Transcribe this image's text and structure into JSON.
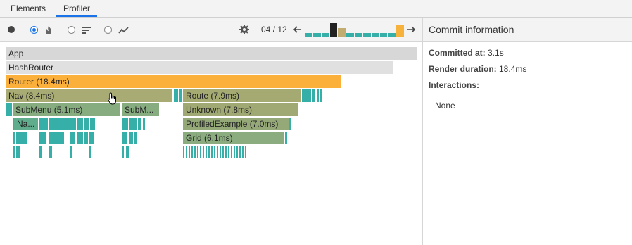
{
  "tabs": [
    {
      "label": "Elements",
      "active": false
    },
    {
      "label": "Profiler",
      "active": true
    }
  ],
  "toolbar": {
    "record_icon": "record-icon",
    "view_modes": [
      {
        "name": "flamegraph",
        "icon": "flame-icon",
        "selected": true
      },
      {
        "name": "ranked",
        "icon": "ranked-bars-icon",
        "selected": false
      },
      {
        "name": "interactions",
        "icon": "line-chart-icon",
        "selected": false
      }
    ],
    "settings_icon": "gear-icon",
    "commit_counter": "04 / 12",
    "prev_icon": "arrow-left-icon",
    "next_icon": "arrow-right-icon",
    "commits": [
      {
        "value": 0.25,
        "color": "#37afa9",
        "selected": false
      },
      {
        "value": 0.25,
        "color": "#37afa9",
        "selected": false
      },
      {
        "value": 0.25,
        "color": "#37afa9",
        "selected": false
      },
      {
        "value": 1.0,
        "color": "#222222",
        "selected": true
      },
      {
        "value": 0.6,
        "color": "#c0ad6f",
        "selected": false
      },
      {
        "value": 0.25,
        "color": "#37afa9",
        "selected": false
      },
      {
        "value": 0.25,
        "color": "#37afa9",
        "selected": false
      },
      {
        "value": 0.25,
        "color": "#37afa9",
        "selected": false
      },
      {
        "value": 0.25,
        "color": "#37afa9",
        "selected": false
      },
      {
        "value": 0.25,
        "color": "#37afa9",
        "selected": false
      },
      {
        "value": 0.25,
        "color": "#37afa9",
        "selected": false
      },
      {
        "value": 0.85,
        "color": "#f7b23b",
        "selected": false
      }
    ]
  },
  "flame_nodes": [
    {
      "label": "App",
      "color": "#d7d7d7"
    },
    {
      "label": "HashRouter",
      "color": "#e0e0e0"
    },
    {
      "label": "Router (18.4ms)",
      "color": "#fbb03b"
    },
    {
      "label": "Nav (8.4ms)",
      "color": "#a8ab74"
    },
    {
      "label": "Route (7.9ms)",
      "color": "#a4aa72"
    },
    {
      "label": "SubMenu (5.1ms)",
      "color": "#86ac80"
    },
    {
      "label": "SubM...",
      "color": "#86ac80"
    },
    {
      "label": "Unknown (7.8ms)",
      "color": "#a0a873"
    },
    {
      "label": "Na...",
      "color": "#60ad8d"
    },
    {
      "label": "ProfiledExample (7.0ms)",
      "color": "#95a878"
    },
    {
      "label": "Grid (6.1ms)",
      "color": "#8aac7f"
    }
  ],
  "right_panel": {
    "title": "Commit information",
    "committed_at_label": "Committed at:",
    "committed_at_value": " 3.1s",
    "render_duration_label": "Render duration:",
    "render_duration_value": " 18.4ms",
    "interactions_label": "Interactions:",
    "interactions_value": "None"
  }
}
